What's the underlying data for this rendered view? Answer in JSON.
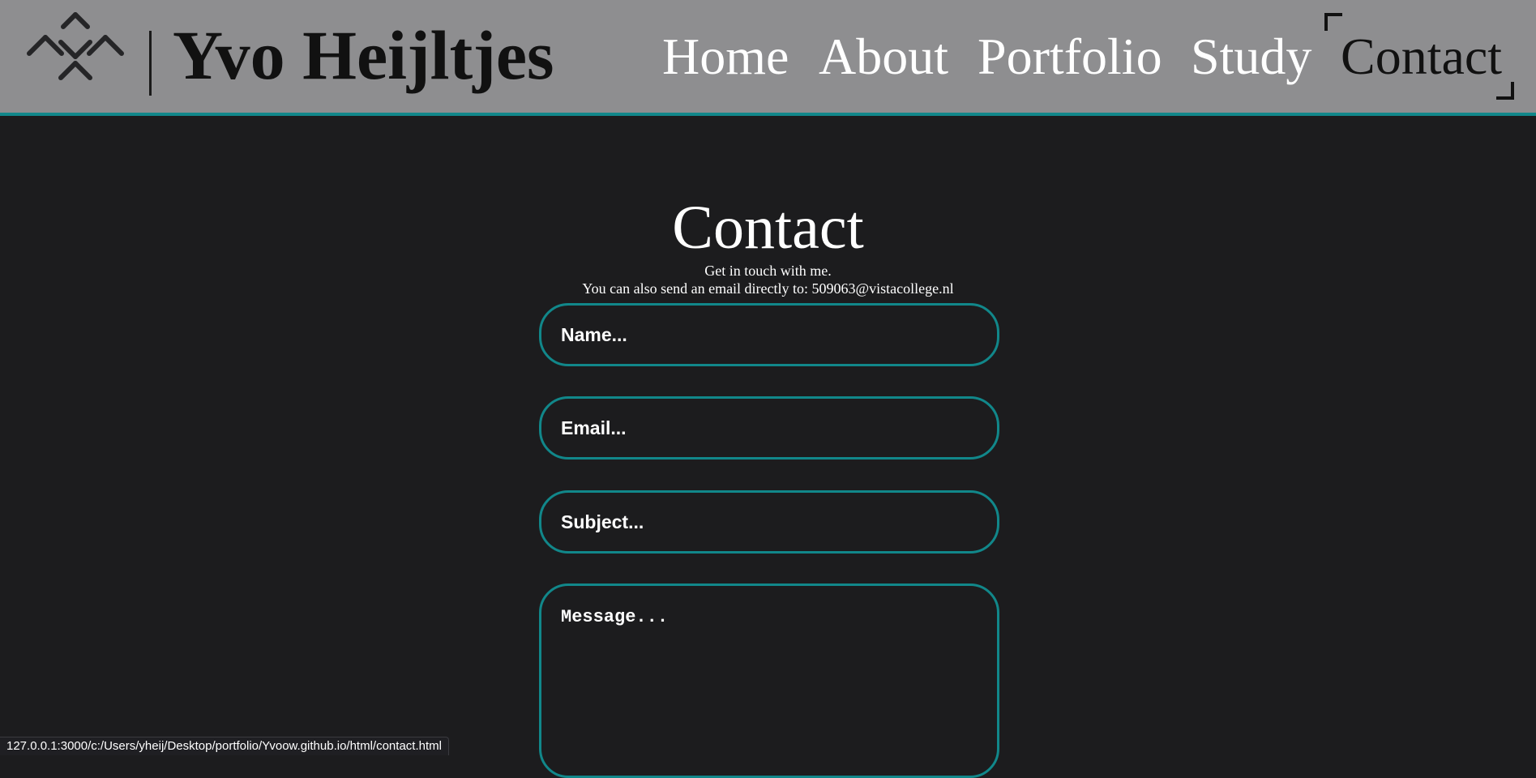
{
  "header": {
    "brand": "Yvo Heijltjes",
    "nav": {
      "home": "Home",
      "about": "About",
      "portfolio": "Portfolio",
      "study": "Study",
      "contact": "Contact"
    },
    "active_nav": "Contact"
  },
  "main": {
    "title": "Contact",
    "subtitle_line1": "Get in touch with me.",
    "subtitle_line2": "You can also send an email directly to: 509063@vistacollege.nl",
    "form": {
      "name_placeholder": "Name...",
      "email_placeholder": "Email...",
      "subject_placeholder": "Subject...",
      "message_placeholder": "Message..."
    }
  },
  "status_bar": {
    "url": "127.0.0.1:3000/c:/Users/yheij/Desktop/portfolio/Yvoow.github.io/html/contact.html"
  },
  "colors": {
    "header_bg": "#8e8e90",
    "page_bg": "#1c1c1e",
    "accent": "#11878a",
    "text_light": "#ffffff",
    "text_dark": "#111111"
  },
  "icons": {
    "logo": "diamond-cross-logo-icon",
    "active_nav_indicator": "corner-brackets-icon"
  }
}
